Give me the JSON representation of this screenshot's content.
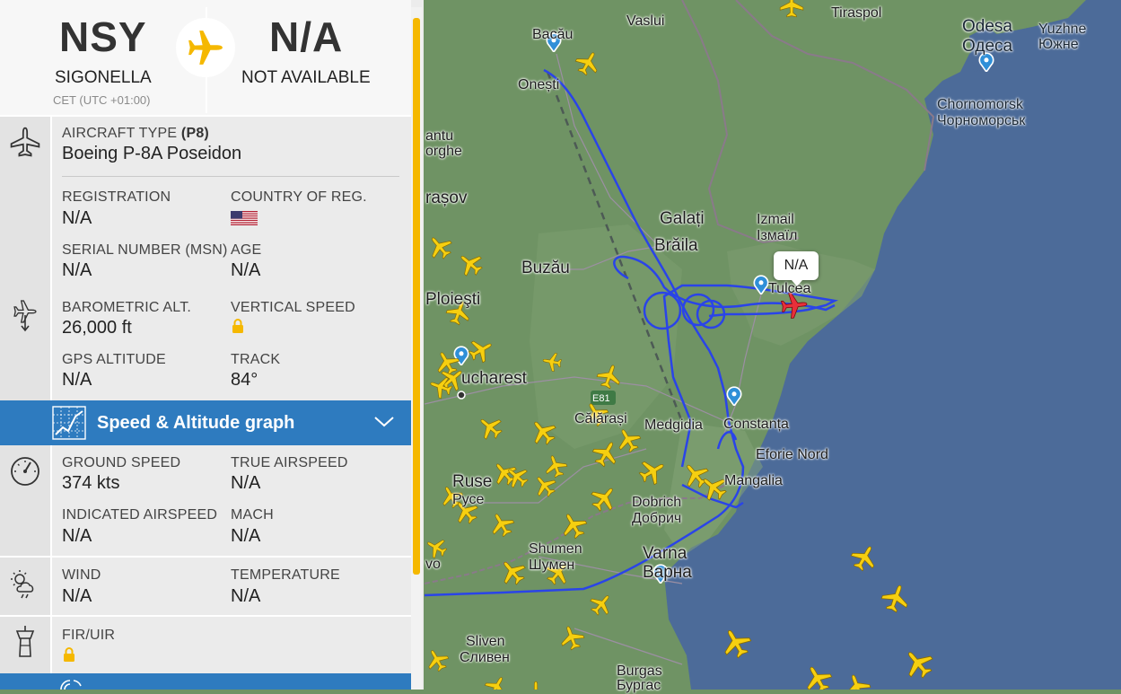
{
  "route": {
    "origin_code": "NSY",
    "origin_city": "SIGONELLA",
    "origin_tz": "CET (UTC +01:00)",
    "dest_code": "N/A",
    "dest_city": "NOT AVAILABLE"
  },
  "aircraft": {
    "type_label": "AIRCRAFT TYPE",
    "type_code": "(P8)",
    "type_value": "Boeing P-8A Poseidon",
    "registration_label": "REGISTRATION",
    "registration_value": "N/A",
    "country_label": "COUNTRY OF REG.",
    "msn_label": "SERIAL NUMBER (MSN)",
    "msn_value": "N/A",
    "age_label": "AGE",
    "age_value": "N/A"
  },
  "altitude": {
    "baro_label": "BAROMETRIC ALT.",
    "baro_value": "26,000 ft",
    "vs_label": "VERTICAL SPEED",
    "gps_label": "GPS ALTITUDE",
    "gps_value": "N/A",
    "track_label": "TRACK",
    "track_value": "84°"
  },
  "graph_bar": {
    "label": "Speed & Altitude graph"
  },
  "speed": {
    "gs_label": "GROUND SPEED",
    "gs_value": "374 kts",
    "tas_label": "TRUE AIRSPEED",
    "tas_value": "N/A",
    "ias_label": "INDICATED AIRSPEED",
    "ias_value": "N/A",
    "mach_label": "MACH",
    "mach_value": "N/A"
  },
  "weather": {
    "wind_label": "WIND",
    "wind_value": "N/A",
    "temp_label": "TEMPERATURE",
    "temp_value": "N/A"
  },
  "fir": {
    "label": "FIR/UIR"
  },
  "map": {
    "callout": "N/A",
    "labels": {
      "bacau": "Bacău",
      "vaslui": "Vaslui",
      "tiraspol": "Tiraspol",
      "odesa": "Odesa",
      "odesa_cyr": "Одеса",
      "yuzhne": "Yuzhne",
      "yuzhne_cyr": "Южне",
      "onesti": "Onești",
      "chornomorsk": "Chornomorsk",
      "chornomorsk_cyr": "Чорноморськ",
      "antu": "antu",
      "orghe": "orghe",
      "brasov": "rașov",
      "galati": "Galați",
      "izmail": "Izmail",
      "izmail_cyr": "Ізмаїл",
      "braila": "Brăila",
      "buzau": "Buzău",
      "tulcea": "Tulcea",
      "ploiesti": "Ploieşti",
      "bucharest": "ucharest",
      "e81": "E81",
      "calarasi": "Călărași",
      "medgidia": "Medgidia",
      "constanta": "Constanța",
      "eforie": "Eforie Nord",
      "ruse": "Ruse",
      "ruse_cyr": "Русе",
      "mangalia": "Mangalia",
      "dobrich": "Dobrich",
      "dobrich_cyr": "Добрич",
      "shumen": "Shumen",
      "shumen_cyr": "Шумен",
      "varna": "Varna",
      "varna_cyr": "Варна",
      "sliven": "Sliven",
      "sliven_cyr": "Сливен",
      "burgas": "Burgas",
      "burgas_cyr": "Бургас",
      "vo": "vo"
    }
  },
  "colors": {
    "accent_blue": "#2e7bbf",
    "track_blue": "#2a44e8",
    "traffic_yellow": "#f6cf10",
    "selected_red": "#e8303a",
    "sea": "#4c6b99",
    "land": "#6f9364",
    "scroll_yellow": "#f5b800"
  }
}
